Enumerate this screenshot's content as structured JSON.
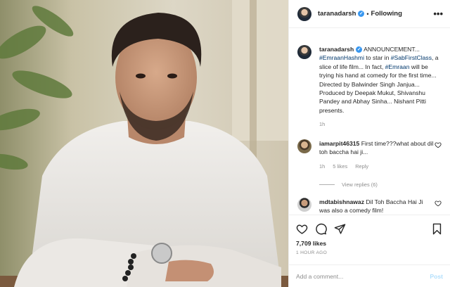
{
  "post": {
    "author": "taranadarsh",
    "follow_label": "Following",
    "more_label": "•••",
    "caption": {
      "username": "taranadarsh",
      "parts": [
        {
          "text": " ANNOUNCEMENT... ",
          "tag": false
        },
        {
          "text": "#EmraanHashmi",
          "tag": true
        },
        {
          "text": " to star in ",
          "tag": false
        },
        {
          "text": "#SabFirstClass",
          "tag": true
        },
        {
          "text": ", a slice of life film... In fact, ",
          "tag": false
        },
        {
          "text": "#Emraan",
          "tag": true
        },
        {
          "text": " will be trying his hand at comedy for the first time... Directed by Balwinder Singh Janjua... Produced by Deepak Mukut, Shivanshu Pandey and Abhay Sinha... Nishant Pitti presents.",
          "tag": false
        }
      ],
      "time": "1h"
    },
    "comments": [
      {
        "username": "iamarpit46315",
        "text": "First time???what about dil toh baccha hai ji...",
        "time": "1h",
        "likes": "5 likes",
        "reply_label": "Reply",
        "view_replies": "View replies (6)"
      },
      {
        "username": "mdtabishnawaz",
        "text": "Dil Toh Baccha Hai Ji was also a comedy film!"
      }
    ],
    "likes": "7,709 likes",
    "posted_ago": "1 HOUR AGO",
    "add_comment_placeholder": "Add a comment...",
    "post_button": "Post"
  },
  "icons": {
    "like": "heart-icon",
    "comment": "comment-icon",
    "share": "paper-plane-icon",
    "save": "bookmark-icon",
    "verified": "verified-badge-icon",
    "more": "more-options-icon"
  },
  "colors": {
    "link": "#00376b",
    "verified": "#3897f0",
    "muted": "#8e8e8e",
    "post_disabled": "#b2dffc"
  }
}
